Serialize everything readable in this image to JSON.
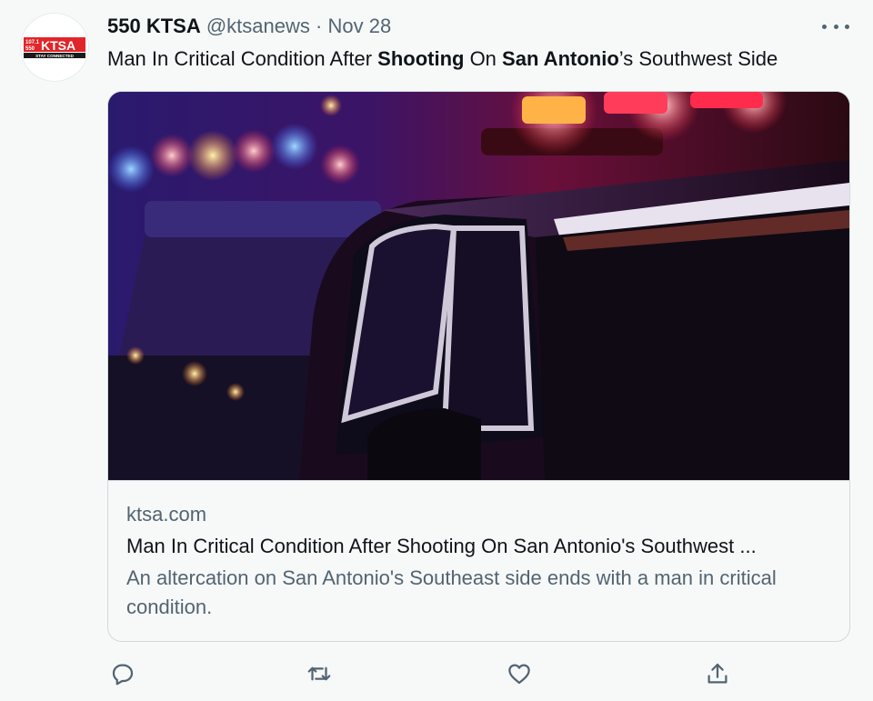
{
  "account": {
    "display_name": "550 KTSA",
    "handle": "@ktsanews",
    "separator": "·",
    "date": "Nov 28",
    "avatar_logo": {
      "freq": "107.1",
      "freq2": "550",
      "brand": "KTSA",
      "tagline": "STAY CONNECTED"
    }
  },
  "tweet": {
    "text_parts": [
      {
        "text": "Man In Critical Condition After ",
        "bold": false
      },
      {
        "text": "Shooting",
        "bold": true
      },
      {
        "text": " On ",
        "bold": false
      },
      {
        "text": "San Antonio",
        "bold": true
      },
      {
        "text": "’s Southwest Side",
        "bold": false
      }
    ]
  },
  "card": {
    "domain": "ktsa.com",
    "title": "Man In Critical Condition After Shooting On San Antonio's Southwest ...",
    "description": "An altercation on San Antonio's Southeast side ends with a man in critical condition."
  },
  "icons": {
    "more": "more-horizontal-icon",
    "reply": "reply-icon",
    "retweet": "retweet-icon",
    "like": "like-icon",
    "share": "share-icon"
  },
  "colors": {
    "background": "#f7f9f9",
    "secondary_text": "#536471",
    "brand_red": "#e0262a"
  }
}
